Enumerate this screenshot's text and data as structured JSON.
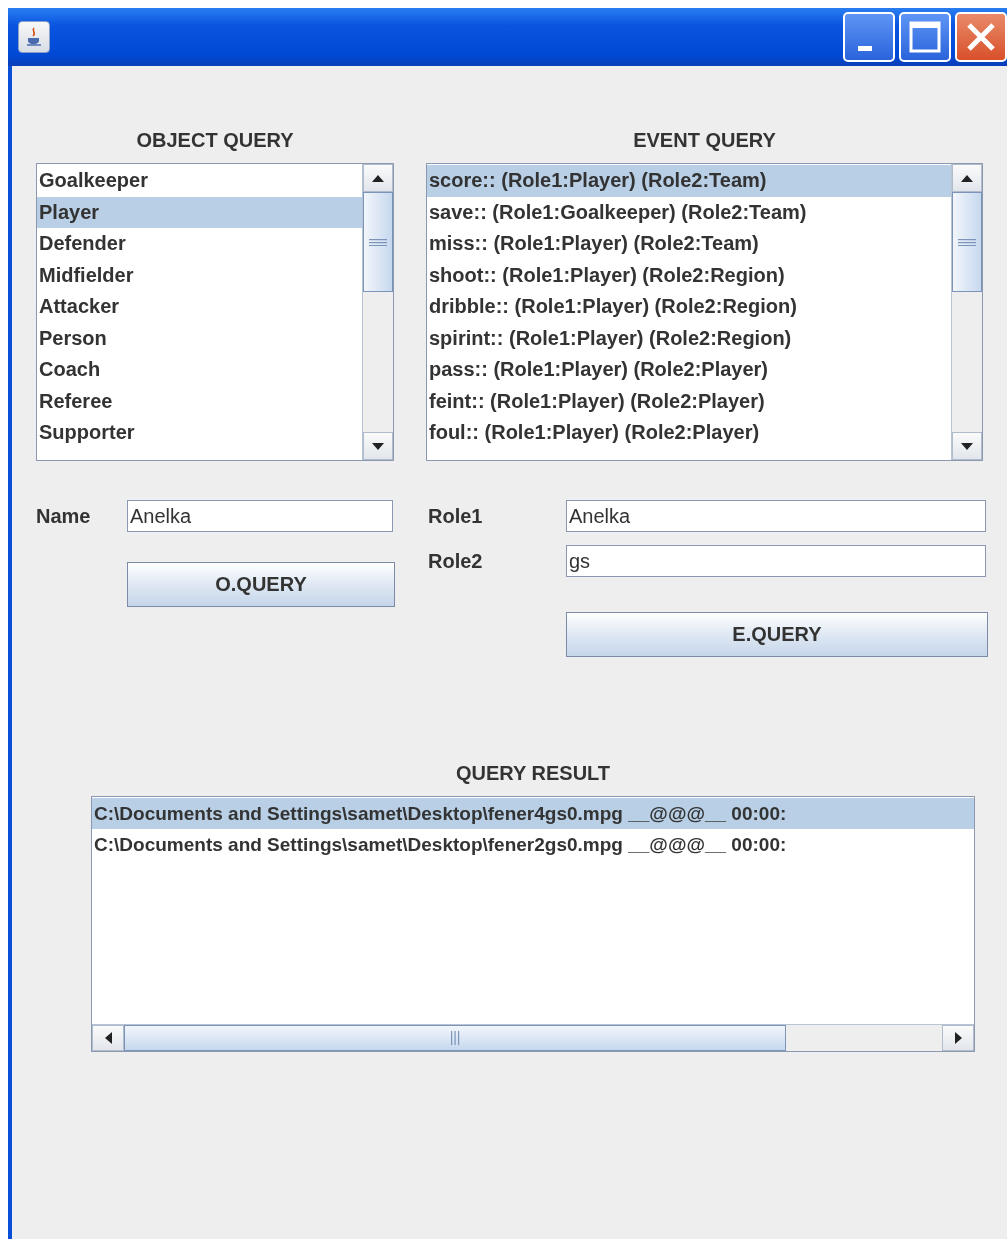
{
  "object_query": {
    "title": "OBJECT QUERY",
    "items": [
      {
        "label": "Goalkeeper",
        "selected": false
      },
      {
        "label": "Player",
        "selected": true
      },
      {
        "label": "Defender",
        "selected": false
      },
      {
        "label": "Midfielder",
        "selected": false
      },
      {
        "label": "Attacker",
        "selected": false
      },
      {
        "label": "Person",
        "selected": false
      },
      {
        "label": "Coach",
        "selected": false
      },
      {
        "label": "Referee",
        "selected": false
      },
      {
        "label": "Supporter",
        "selected": false
      }
    ],
    "name_label": "Name",
    "name_value": "Anelka",
    "button": "O.QUERY"
  },
  "event_query": {
    "title": "EVENT QUERY",
    "items": [
      {
        "label": "score:: (Role1:Player) (Role2:Team)",
        "selected": true
      },
      {
        "label": "save:: (Role1:Goalkeeper) (Role2:Team)",
        "selected": false
      },
      {
        "label": "miss:: (Role1:Player) (Role2:Team)",
        "selected": false
      },
      {
        "label": "shoot:: (Role1:Player) (Role2:Region)",
        "selected": false
      },
      {
        "label": "dribble:: (Role1:Player) (Role2:Region)",
        "selected": false
      },
      {
        "label": "spirint:: (Role1:Player) (Role2:Region)",
        "selected": false
      },
      {
        "label": "pass:: (Role1:Player) (Role2:Player)",
        "selected": false
      },
      {
        "label": "feint:: (Role1:Player) (Role2:Player)",
        "selected": false
      },
      {
        "label": "foul:: (Role1:Player) (Role2:Player)",
        "selected": false
      }
    ],
    "role1_label": "Role1",
    "role1_value": "Anelka",
    "role2_label": "Role2",
    "role2_value": "gs",
    "button": "E.QUERY"
  },
  "query_result": {
    "title": "QUERY RESULT",
    "items": [
      {
        "label": "C:\\Documents and Settings\\samet\\Desktop\\fener4gs0.mpg __@@@__ 00:00:",
        "selected": true
      },
      {
        "label": "C:\\Documents and Settings\\samet\\Desktop\\fener2gs0.mpg __@@@__ 00:00:",
        "selected": false
      }
    ]
  }
}
